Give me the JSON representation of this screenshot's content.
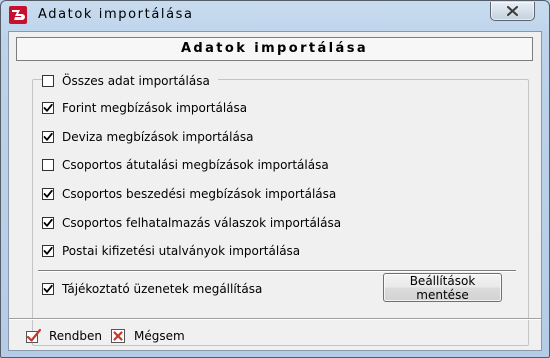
{
  "window": {
    "title": "Adatok importálása",
    "close_icon": "close-icon"
  },
  "panel": {
    "header": "Adatok importálása"
  },
  "options": {
    "all": {
      "label": "Összes adat importálása",
      "checked": false
    },
    "items": [
      {
        "label": "Forint megbízások importálása",
        "checked": true
      },
      {
        "label": "Deviza megbízások importálása",
        "checked": true
      },
      {
        "label": "Csoportos átutalási megbízások importálása",
        "checked": false
      },
      {
        "label": "Csoportos beszedési megbízások importálása",
        "checked": true
      },
      {
        "label": "Csoportos felhatalmazás válaszok importálása",
        "checked": true
      },
      {
        "label": "Postai kifizetési utalványok importálása",
        "checked": true
      }
    ],
    "info": {
      "label": "Tájékoztató üzenetek megállítása",
      "checked": true
    }
  },
  "buttons": {
    "save_settings": "Beállítások mentése",
    "ok": "Rendben",
    "cancel": "Mégsem"
  },
  "colors": {
    "window_frame": "#bcd3ea",
    "client_bg": "#f0f0f0",
    "check": "#000000",
    "ok_icon": "#c0392b",
    "cancel_icon": "#c0392b",
    "app_icon": "#c8102e"
  }
}
